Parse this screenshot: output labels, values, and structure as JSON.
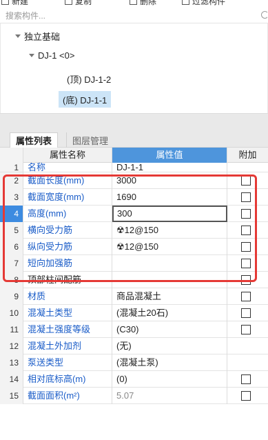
{
  "toolbar": {
    "items": [
      "新建",
      "复制",
      "删除",
      "过滤构件"
    ]
  },
  "search": {
    "placeholder": "搜索构件..."
  },
  "tree": {
    "root": "独立基础",
    "child": "DJ-1 <0>",
    "leaves": [
      "(顶) DJ-1-2",
      "(底) DJ-1-1"
    ],
    "selected_leaf": "(底) DJ-1-1"
  },
  "tabs": {
    "active": "属性列表",
    "inactive": "图层管理"
  },
  "grid": {
    "headers": {
      "name": "属性名称",
      "value": "属性值",
      "extra": "附加"
    },
    "rows": [
      {
        "num": "1",
        "name": "名称",
        "value": "DJ-1-1",
        "check": false
      },
      {
        "num": "2",
        "name": "截面长度(mm)",
        "value": "3000",
        "check": true
      },
      {
        "num": "3",
        "name": "截面宽度(mm)",
        "value": "1690",
        "check": true
      },
      {
        "num": "4",
        "name": "高度(mm)",
        "value": "300",
        "check": true
      },
      {
        "num": "5",
        "name": "横向受力筋",
        "value": "☢12@150",
        "check": true
      },
      {
        "num": "6",
        "name": "纵向受力筋",
        "value": "☢12@150",
        "check": true
      },
      {
        "num": "7",
        "name": "短向加强筋",
        "value": "",
        "check": true
      },
      {
        "num": "8",
        "name": "顶部柱间配筋",
        "value": "",
        "check": true
      },
      {
        "num": "9",
        "name": "材质",
        "value": "商品混凝土",
        "check": true
      },
      {
        "num": "10",
        "name": "混凝土类型",
        "value": "(混凝土20石)",
        "check": true
      },
      {
        "num": "11",
        "name": "混凝土强度等级",
        "value": "(C30)",
        "check": true
      },
      {
        "num": "12",
        "name": "混凝土外加剂",
        "value": "(无)",
        "check": false
      },
      {
        "num": "13",
        "name": "泵送类型",
        "value": "(混凝土泵)",
        "check": false
      },
      {
        "num": "14",
        "name": "相对底标高(m)",
        "value": "(0)",
        "check": true
      },
      {
        "num": "15",
        "name": "截面面积(m²)",
        "value": "5.07",
        "check": true
      }
    ],
    "selected_row": "4"
  },
  "colors": {
    "accent": "#4e95dc",
    "name_text": "#1a5cc8",
    "highlight_frame": "#e53935",
    "selection": "#cce4f7"
  }
}
